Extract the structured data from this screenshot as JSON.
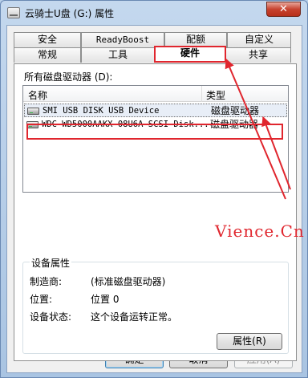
{
  "window": {
    "title": "云骑士U盘 (G:) 属性",
    "close_label": "✕"
  },
  "tabs_row1": [
    {
      "label": "安全"
    },
    {
      "label": "ReadyBoost"
    },
    {
      "label": "配额"
    },
    {
      "label": "自定义"
    }
  ],
  "tabs_row2": [
    {
      "label": "常规"
    },
    {
      "label": "工具"
    },
    {
      "label": "硬件",
      "active": true
    },
    {
      "label": "共享"
    }
  ],
  "hardware": {
    "list_label": "所有磁盘驱动器 (D):",
    "columns": {
      "name": "名称",
      "type": "类型"
    },
    "rows": [
      {
        "name": "SMI USB DISK USB Device",
        "type": "磁盘驱动器",
        "selected": true
      },
      {
        "name": "WDC WD5000AAKX-08U6A SCSI Disk...",
        "type": "磁盘驱动器",
        "selected": false
      }
    ]
  },
  "watermark": "Vience.Cn",
  "device_props": {
    "title": "设备属性",
    "manufacturer_label": "制造商:",
    "manufacturer_value": "(标准磁盘驱动器)",
    "location_label": "位置:",
    "location_value": "位置 0",
    "status_label": "设备状态:",
    "status_value": "这个设备运转正常。",
    "properties_button": "属性(R)"
  },
  "buttons": {
    "ok": "确定",
    "cancel": "取消",
    "apply": "应用(A)"
  },
  "colors": {
    "annotation": "#e0262e",
    "selection": "#e8eef7"
  }
}
